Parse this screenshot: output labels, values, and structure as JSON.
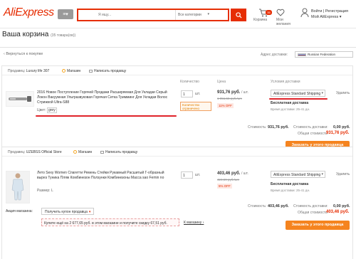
{
  "header": {
    "logo": "AliExpress",
    "search_placeholder": "Я ищу...",
    "category": "Все категории",
    "cart_count": "35",
    "cart_label": "Корзина",
    "wish_line1": "Мои",
    "wish_line2": "желания",
    "account_line1": "Войти | Регистрация",
    "account_line2": "Мой AliExpress ▾"
  },
  "page": {
    "title": "Ваша корзина",
    "count": "(35 товара(ов))",
    "back": "‹ Вернуться к покупке",
    "ship_to_label": "Адрес доставки:",
    "ship_to_value": "Russian Federation"
  },
  "columns": {
    "qty": "Количество",
    "price": "Цена",
    "delivery": "Условия доставки"
  },
  "section1": {
    "seller_prefix": "Продавец:",
    "seller_name": "Luxury life 307",
    "store_link": "Магазин",
    "contact_link": "Написать продавцу",
    "product_title": "2016 Новое Поступление Горячей Продажи Расширяемая Для Укладки Серый Локон Вакуумная Ультразвуковая Горячая Сетка Тримминг Для Укладки Волос Стрижкой Ultra-S88",
    "product_color_label": "Цвет:",
    "product_color_value": "grey",
    "qty": "1",
    "qty_unit": "шт.",
    "price": "931,76 руб.",
    "price_unit": "/ шт.",
    "old_price": "1 051,55 руб./шт.",
    "off": "11% OFF",
    "limit": "Количество ограничено",
    "shipping": "AliExpress Standard Shipping",
    "free_ship": "Бесплатная доставка",
    "delivery_time": "Время доставки: 25-41 дн.",
    "remove": "Удалить",
    "cost_label": "Стоимость:",
    "cost_value": "931,76 руб.",
    "ship_cost_label": "Стоимость доставки:",
    "ship_cost_value": "0,00 руб.",
    "total_label": "Общая стоимость:",
    "total_value": "931,76 руб.",
    "order_btn": "Заказать у этого продавца"
  },
  "section2": {
    "seller_prefix": "Продавец:",
    "seller_name": "UZEBSS Official Store",
    "store_link": "Магазин",
    "contact_link": "Написать продавцу",
    "product_title": "Лето Sexy Women Спагетти Ремень Стейки Рукавный Расшитый Г-образный вырез Туника Пляж Комбинезон Ползунки Комбинезоны Мaсса sao Femin no",
    "size_label": "Размер:",
    "size_value": "L",
    "qty": "1",
    "qty_unit": "шт.",
    "price": "403,46 руб.",
    "price_unit": "/ шт.",
    "old_price": "424,69 руб./шт.",
    "off": "5% OFF",
    "shipping": "AliExpress Standard Shipping",
    "free_ship": "Бесплатная доставка",
    "delivery_time": "Время доставки: 25-41 дн.",
    "remove": "Удалить",
    "coupon_label": "Акция магазина:",
    "coupon_btn": "Получить купон продавца",
    "promo_text": "Купите ещё на 2 677,65 руб. в этом магазине и получите скидку 67,51 руб.",
    "promo_link": "К магазину ›",
    "cost_label": "Стоимость:",
    "cost_value": "403,46 руб.",
    "ship_cost_label": "Стоимость доставки:",
    "ship_cost_value": "0,00 руб.",
    "total_label": "Общая стоимость:",
    "total_value": "403,46 руб.",
    "order_btn": "Заказать у этого продавца"
  },
  "colors": {
    "brand": "#e62e04",
    "order_button": "#f5841f",
    "annotation": "#e0232a"
  }
}
